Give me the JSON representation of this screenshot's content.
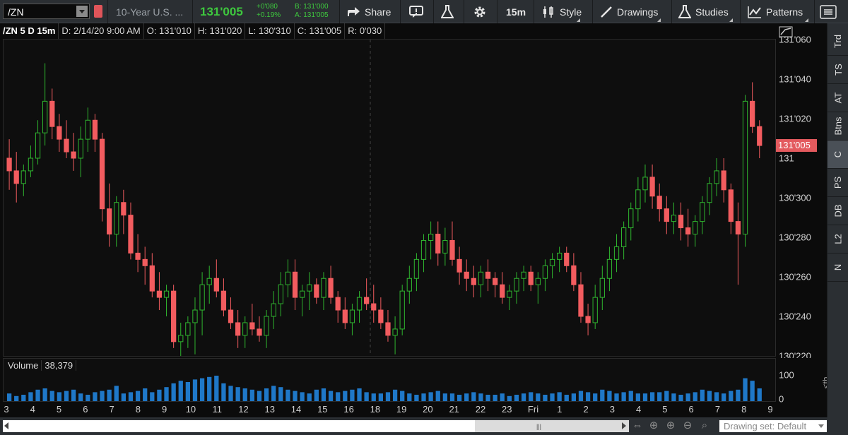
{
  "toolbar": {
    "symbol": "/ZN",
    "description": "10-Year U.S. ...",
    "last_price": "131'005",
    "net_change": "+0'080",
    "pct_change": "+0.19%",
    "bid": "B: 131'000",
    "ask": "A: 131'005",
    "share_label": "Share",
    "timeframe_label": "15m",
    "style_label": "Style",
    "drawings_label": "Drawings",
    "studies_label": "Studies",
    "patterns_label": "Patterns"
  },
  "infobar": {
    "symbol": "/ZN 5 D 15m",
    "date": "D: 2/14/20 9:00 AM",
    "open": "O: 131'010",
    "high": "H: 131'020",
    "low": "L: 130'310",
    "close": "C: 131'005",
    "range": "R: 0'030"
  },
  "price_axis": {
    "ticks": [
      "131'060",
      "131'040",
      "131'020",
      "131",
      "130'300",
      "130'280",
      "130'260",
      "130'240",
      "130'220"
    ],
    "last_tag": "131'005"
  },
  "volume": {
    "label": "Volume",
    "value": "38,379",
    "axis_ticks": [
      "100",
      "0"
    ],
    "th_label": "<th..."
  },
  "x_axis": {
    "labels": [
      "3",
      "4",
      "5",
      "6",
      "7",
      "8",
      "9",
      "10",
      "11",
      "12",
      "13",
      "14",
      "15",
      "16",
      "18",
      "19",
      "20",
      "21",
      "22",
      "23",
      "Fri",
      "1",
      "2",
      "3",
      "4",
      "5",
      "6",
      "7",
      "8",
      "9"
    ]
  },
  "sidebar": {
    "tabs": [
      "Trd",
      "TS",
      "AT",
      "Btns",
      "C",
      "PS",
      "DB",
      "L2",
      "N"
    ],
    "active": "C"
  },
  "bottombar": {
    "drawing_set": "Drawing set: Default"
  },
  "colors": {
    "up": "#2fb52f",
    "down": "#f25c5f",
    "volume": "#1f78c8",
    "background": "#0b0b0b"
  },
  "chart_data": {
    "type": "candlestick",
    "price_scale": "1/32nds (130'300 = 130 + 30/32)",
    "y_range_decimal": [
      130.6875,
      131.1875
    ],
    "candles_ohlc_decimal": [
      [
        131.0,
        131.03,
        130.95,
        130.98
      ],
      [
        130.98,
        131.01,
        130.93,
        130.96
      ],
      [
        130.96,
        130.99,
        130.94,
        130.98
      ],
      [
        130.98,
        131.02,
        130.97,
        131.0
      ],
      [
        131.0,
        131.06,
        130.99,
        131.04
      ],
      [
        131.04,
        131.15,
        131.02,
        131.09
      ],
      [
        131.09,
        131.11,
        131.03,
        131.05
      ],
      [
        131.05,
        131.07,
        131.01,
        131.03
      ],
      [
        131.03,
        131.06,
        131.0,
        131.01
      ],
      [
        131.01,
        131.04,
        130.98,
        131.0
      ],
      [
        131.0,
        131.05,
        130.97,
        131.03
      ],
      [
        131.03,
        131.08,
        131.01,
        131.06
      ],
      [
        131.06,
        131.07,
        131.01,
        131.03
      ],
      [
        131.03,
        131.04,
        130.9,
        130.92
      ],
      [
        130.92,
        130.96,
        130.86,
        130.88
      ],
      [
        130.88,
        130.94,
        130.86,
        130.93
      ],
      [
        130.93,
        130.95,
        130.88,
        130.91
      ],
      [
        130.91,
        130.93,
        130.84,
        130.85
      ],
      [
        130.85,
        130.88,
        130.82,
        130.84
      ],
      [
        130.84,
        130.86,
        130.8,
        130.83
      ],
      [
        130.83,
        130.85,
        130.78,
        130.79
      ],
      [
        130.79,
        130.82,
        130.76,
        130.78
      ],
      [
        130.78,
        130.8,
        130.75,
        130.79
      ],
      [
        130.79,
        130.8,
        130.7,
        130.71
      ],
      [
        130.71,
        130.74,
        130.68,
        130.72
      ],
      [
        130.72,
        130.75,
        130.7,
        130.74
      ],
      [
        130.74,
        130.78,
        130.69,
        130.76
      ],
      [
        130.76,
        130.82,
        130.72,
        130.8
      ],
      [
        130.8,
        130.83,
        130.77,
        130.81
      ],
      [
        130.81,
        130.84,
        130.78,
        130.79
      ],
      [
        130.79,
        130.81,
        130.75,
        130.76
      ],
      [
        130.76,
        130.78,
        130.73,
        130.74
      ],
      [
        130.74,
        130.76,
        130.7,
        130.72
      ],
      [
        130.72,
        130.75,
        130.7,
        130.74
      ],
      [
        130.74,
        130.77,
        130.72,
        130.73
      ],
      [
        130.73,
        130.75,
        130.71,
        130.72
      ],
      [
        130.72,
        130.76,
        130.7,
        130.75
      ],
      [
        130.75,
        130.79,
        130.73,
        130.77
      ],
      [
        130.77,
        130.82,
        130.75,
        130.8
      ],
      [
        130.8,
        130.84,
        130.78,
        130.82
      ],
      [
        130.82,
        130.84,
        130.76,
        130.78
      ],
      [
        130.78,
        130.8,
        130.75,
        130.79
      ],
      [
        130.79,
        130.82,
        130.76,
        130.8
      ],
      [
        130.8,
        130.81,
        130.77,
        130.78
      ],
      [
        130.78,
        130.82,
        130.76,
        130.81
      ],
      [
        130.81,
        130.83,
        130.77,
        130.78
      ],
      [
        130.78,
        130.79,
        130.74,
        130.76
      ],
      [
        130.76,
        130.78,
        130.73,
        130.74
      ],
      [
        130.74,
        130.77,
        130.72,
        130.76
      ],
      [
        130.76,
        130.79,
        130.74,
        130.78
      ],
      [
        130.78,
        130.81,
        130.76,
        130.77
      ],
      [
        130.77,
        130.8,
        130.74,
        130.76
      ],
      [
        130.76,
        130.78,
        130.73,
        130.74
      ],
      [
        130.74,
        130.76,
        130.71,
        130.72
      ],
      [
        130.72,
        130.75,
        130.69,
        130.73
      ],
      [
        130.73,
        130.8,
        130.72,
        130.79
      ],
      [
        130.79,
        130.83,
        130.77,
        130.81
      ],
      [
        130.81,
        130.85,
        130.79,
        130.84
      ],
      [
        130.84,
        130.88,
        130.82,
        130.87
      ],
      [
        130.87,
        130.9,
        130.84,
        130.88
      ],
      [
        130.88,
        130.9,
        130.83,
        130.85
      ],
      [
        130.85,
        130.89,
        130.83,
        130.87
      ],
      [
        130.87,
        130.9,
        130.83,
        130.84
      ],
      [
        130.84,
        130.86,
        130.8,
        130.82
      ],
      [
        130.82,
        130.84,
        130.79,
        130.81
      ],
      [
        130.81,
        130.83,
        130.78,
        130.8
      ],
      [
        130.8,
        130.83,
        130.78,
        130.82
      ],
      [
        130.82,
        130.84,
        130.79,
        130.81
      ],
      [
        130.81,
        130.82,
        130.78,
        130.8
      ],
      [
        130.8,
        130.82,
        130.77,
        130.78
      ],
      [
        130.78,
        130.8,
        130.76,
        130.79
      ],
      [
        130.79,
        130.82,
        130.77,
        130.81
      ],
      [
        130.81,
        130.83,
        130.79,
        130.82
      ],
      [
        130.82,
        130.83,
        130.79,
        130.8
      ],
      [
        130.8,
        130.82,
        130.77,
        130.81
      ],
      [
        130.81,
        130.84,
        130.79,
        130.83
      ],
      [
        130.83,
        130.85,
        130.81,
        130.84
      ],
      [
        130.84,
        130.86,
        130.82,
        130.85
      ],
      [
        130.85,
        130.86,
        130.82,
        130.83
      ],
      [
        130.83,
        130.85,
        130.79,
        130.8
      ],
      [
        130.8,
        130.82,
        130.74,
        130.75
      ],
      [
        130.75,
        130.77,
        130.72,
        130.74
      ],
      [
        130.74,
        130.8,
        130.73,
        130.78
      ],
      [
        130.78,
        130.83,
        130.76,
        130.81
      ],
      [
        130.81,
        130.86,
        130.79,
        130.84
      ],
      [
        130.84,
        130.88,
        130.82,
        130.86
      ],
      [
        130.86,
        130.9,
        130.84,
        130.89
      ],
      [
        130.89,
        130.93,
        130.87,
        130.92
      ],
      [
        130.92,
        130.97,
        130.9,
        130.95
      ],
      [
        130.95,
        130.99,
        130.93,
        130.97
      ],
      [
        130.97,
        130.99,
        130.92,
        130.94
      ],
      [
        130.94,
        130.96,
        130.9,
        130.92
      ],
      [
        130.92,
        130.94,
        130.88,
        130.9
      ],
      [
        130.9,
        130.93,
        130.88,
        130.91
      ],
      [
        130.91,
        130.93,
        130.87,
        130.89
      ],
      [
        130.89,
        130.92,
        130.86,
        130.88
      ],
      [
        130.88,
        130.91,
        130.86,
        130.9
      ],
      [
        130.9,
        130.94,
        130.88,
        130.93
      ],
      [
        130.93,
        130.97,
        130.91,
        130.96
      ],
      [
        130.96,
        131.0,
        130.94,
        130.98
      ],
      [
        130.98,
        131.0,
        130.93,
        130.95
      ],
      [
        130.95,
        130.96,
        130.88,
        130.9
      ],
      [
        130.9,
        130.93,
        130.8,
        130.88
      ],
      [
        130.88,
        131.1,
        130.86,
        131.09
      ],
      [
        131.09,
        131.12,
        131.04,
        131.05
      ],
      [
        131.05,
        131.06,
        131.0,
        131.02
      ]
    ],
    "volume": [
      30,
      20,
      25,
      35,
      45,
      50,
      40,
      35,
      40,
      45,
      30,
      25,
      35,
      40,
      45,
      60,
      30,
      35,
      40,
      50,
      35,
      45,
      55,
      70,
      80,
      75,
      85,
      90,
      95,
      100,
      70,
      60,
      55,
      50,
      45,
      40,
      50,
      60,
      55,
      45,
      40,
      35,
      30,
      45,
      50,
      40,
      35,
      40,
      45,
      50,
      35,
      30,
      30,
      35,
      45,
      40,
      30,
      25,
      30,
      35,
      40,
      30,
      30,
      25,
      30,
      35,
      30,
      25,
      25,
      30,
      20,
      25,
      30,
      35,
      30,
      25,
      30,
      35,
      25,
      30,
      40,
      35,
      30,
      45,
      40,
      30,
      35,
      40,
      30,
      30,
      35,
      35,
      40,
      30,
      25,
      30,
      35,
      45,
      40,
      35,
      30,
      40,
      45,
      90,
      80,
      50
    ]
  }
}
